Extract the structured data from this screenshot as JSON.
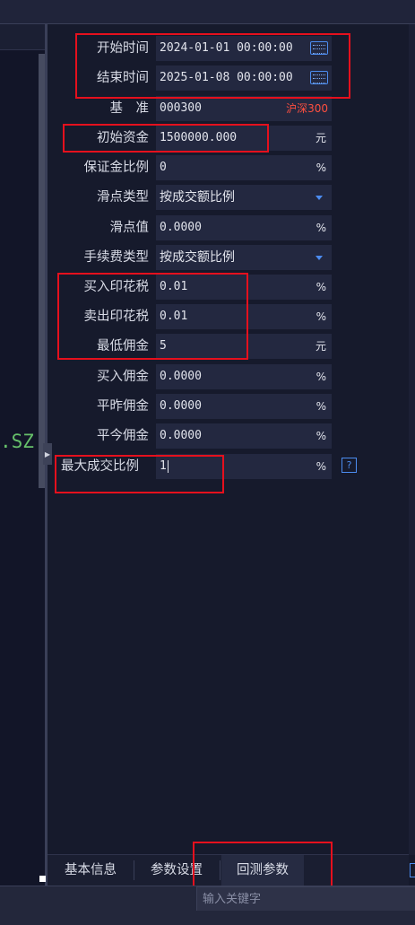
{
  "left_pane": {
    "code_fragment": ".SZ"
  },
  "form": {
    "start_time": {
      "label": "开始时间",
      "value": "2024-01-01 00:00:00",
      "icon": "calendar-icon"
    },
    "end_time": {
      "label": "结束时间",
      "value": "2025-01-08 00:00:00",
      "icon": "calendar-icon"
    },
    "benchmark": {
      "label": "基　准",
      "value": "000300",
      "name": "沪深300",
      "name_color": "#ff4f3f"
    },
    "initial_capital": {
      "label": "初始资金",
      "value": "1500000.000",
      "unit": "元"
    },
    "margin_ratio": {
      "label": "保证金比例",
      "value": "0",
      "unit": "%"
    },
    "slippage_type": {
      "label": "滑点类型",
      "value": "按成交额比例"
    },
    "slippage_value": {
      "label": "滑点值",
      "value": "0.0000",
      "unit": "%"
    },
    "fee_type": {
      "label": "手续费类型",
      "value": "按成交额比例"
    },
    "buy_stamp_tax": {
      "label": "买入印花税",
      "value": "0.01",
      "unit": "%"
    },
    "sell_stamp_tax": {
      "label": "卖出印花税",
      "value": "0.01",
      "unit": "%"
    },
    "min_commission": {
      "label": "最低佣金",
      "value": "5",
      "unit": "元"
    },
    "buy_commission": {
      "label": "买入佣金",
      "value": "0.0000",
      "unit": "%"
    },
    "close_yesterday_commission": {
      "label": "平昨佣金",
      "value": "0.0000",
      "unit": "%"
    },
    "close_today_commission": {
      "label": "平今佣金",
      "value": "0.0000",
      "unit": "%"
    },
    "max_fill_ratio": {
      "label": "最大成交比例",
      "value": "1",
      "unit": "%",
      "help": "?"
    }
  },
  "tabs": [
    {
      "label": "基本信息",
      "active": false
    },
    {
      "label": "参数设置",
      "active": false
    },
    {
      "label": "回测参数",
      "active": true
    }
  ],
  "search": {
    "placeholder": "输入关键字"
  },
  "colors": {
    "highlight": "#e5101d",
    "accent": "#4c8cf0",
    "background": "#161a2c"
  }
}
